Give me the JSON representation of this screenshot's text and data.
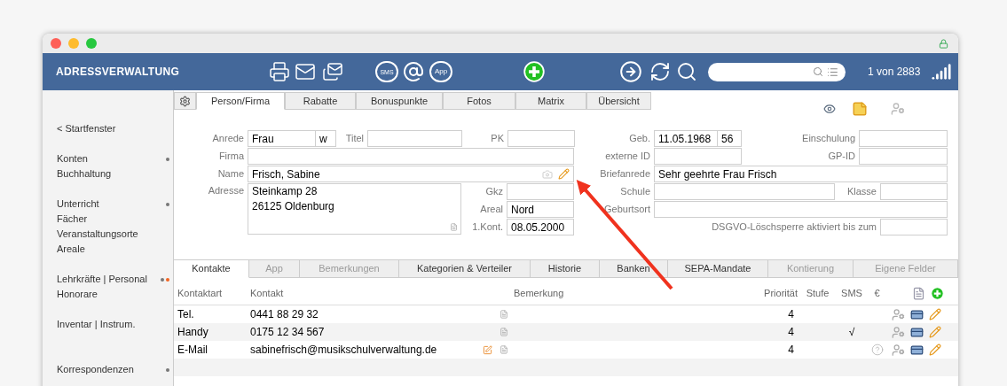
{
  "header": {
    "title": "ADRESSVERWALTUNG",
    "sms_label": "SMS",
    "app_label": "App",
    "record_counter": "1 von 2883"
  },
  "sidebar": {
    "back": "< Startfenster",
    "groups": [
      {
        "items": [
          "Konten",
          "Buchhaltung"
        ],
        "dots": [
          {
            "color": "#777777"
          }
        ]
      },
      {
        "items": [
          "Unterricht",
          "Fächer",
          "Veranstaltungsorte",
          "Areale"
        ],
        "dots": [
          {
            "color": "#777777"
          }
        ]
      },
      {
        "items": [
          "Lehrkräfte | Personal",
          "Honorare"
        ],
        "dots": [
          {
            "color": "#777777"
          },
          {
            "color": "#f26522"
          }
        ]
      },
      {
        "items": [
          "Inventar | Instrum."
        ]
      },
      {
        "items": [
          "Korrespondenzen"
        ],
        "dots": [
          {
            "color": "#777777"
          }
        ]
      }
    ]
  },
  "tabs": [
    {
      "label": "Person/Firma",
      "selected": true
    },
    {
      "label": "Rabatte",
      "selected": false
    },
    {
      "label": "Bonuspunkte",
      "selected": false
    },
    {
      "label": "Fotos",
      "selected": false
    },
    {
      "label": "Matrix",
      "selected": false
    },
    {
      "label": "Übersicht",
      "selected": false
    }
  ],
  "form": {
    "anrede": {
      "label": "Anrede",
      "value": "Frau"
    },
    "gender": "w",
    "titel": {
      "label": "Titel"
    },
    "pk": {
      "label": "PK"
    },
    "firma": {
      "label": "Firma"
    },
    "name": {
      "label": "Name",
      "value": "Frisch, Sabine"
    },
    "adresse": {
      "label": "Adresse",
      "lines": [
        "Steinkamp 28",
        "26125 Oldenburg"
      ]
    },
    "gkz": {
      "label": "Gkz"
    },
    "areal": {
      "label": "Areal",
      "value": "Nord"
    },
    "kontakt1": {
      "label": "1.Kont.",
      "value": "08.05.2000"
    },
    "geb": {
      "label": "Geb.",
      "value": "11.05.1968"
    },
    "age": "56",
    "einschulung": {
      "label": "Einschulung"
    },
    "externe_id": {
      "label": "externe ID"
    },
    "gp_id": {
      "label": "GP-ID"
    },
    "briefanrede": {
      "label": "Briefanrede",
      "value": "Sehr geehrte Frau Frisch"
    },
    "schule": {
      "label": "Schule"
    },
    "klasse": {
      "label": "Klasse"
    },
    "geburtsort": {
      "label": "Geburtsort"
    },
    "dsgvo": {
      "label": "DSGVO-Löschsperre aktiviert bis zum"
    }
  },
  "lower_tabs": [
    {
      "label": "Kontakte",
      "selected": true,
      "disabled": false
    },
    {
      "label": "App",
      "selected": false,
      "disabled": true
    },
    {
      "label": "Bemerkungen",
      "selected": false,
      "disabled": true
    },
    {
      "label": "Kategorien & Verteiler",
      "selected": false,
      "disabled": false
    },
    {
      "label": "Historie",
      "selected": false,
      "disabled": false
    },
    {
      "label": "Banken",
      "selected": false,
      "disabled": false
    },
    {
      "label": "SEPA-Mandate",
      "selected": false,
      "disabled": false
    },
    {
      "label": "Kontierung",
      "selected": false,
      "disabled": true
    },
    {
      "label": "Eigene Felder",
      "selected": false,
      "disabled": true
    }
  ],
  "contacts": {
    "columns": [
      "Kontaktart",
      "Kontakt",
      "Bemerkung",
      "Priorität",
      "Stufe",
      "SMS",
      "€"
    ],
    "rows": [
      {
        "type": "Tel.",
        "contact": "0441 88 29 32",
        "priority": "4",
        "compose_icon": false,
        "help_icon": false
      },
      {
        "type": "Handy",
        "contact": "0175 12 34 567",
        "priority": "4",
        "sms": "√",
        "compose_icon": false,
        "help_icon": false
      },
      {
        "type": "E-Mail",
        "contact": "sabinefrisch@musikschulverwaltung.de",
        "priority": "4",
        "compose_icon": true,
        "help_icon": true
      }
    ]
  }
}
